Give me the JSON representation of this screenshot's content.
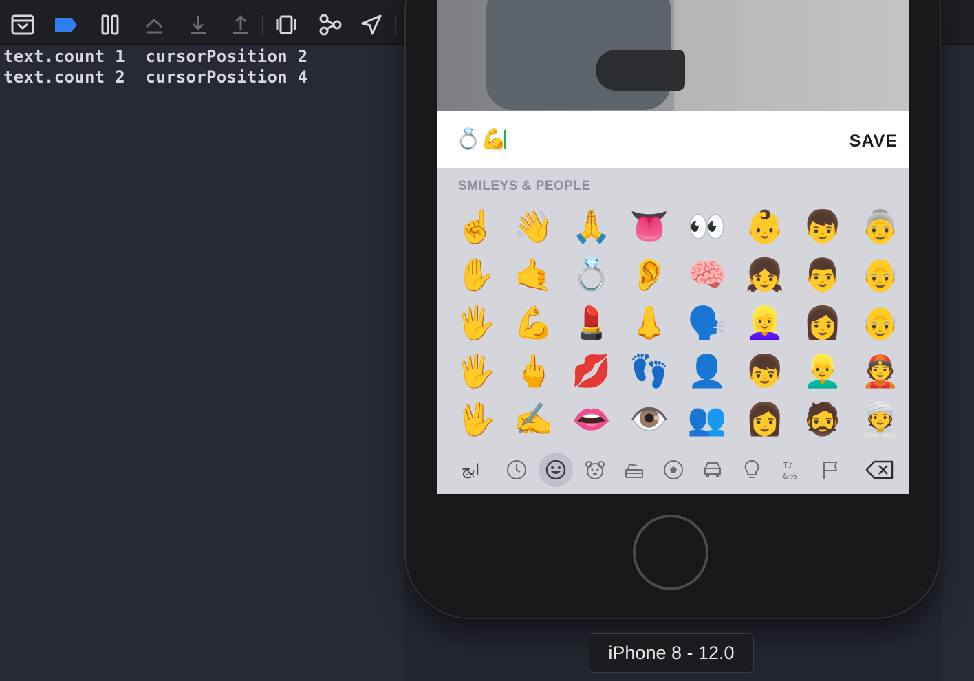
{
  "debug_toolbar": {
    "buttons": [
      {
        "name": "hide-debug-area-icon"
      },
      {
        "name": "breakpoints-toggle-icon"
      },
      {
        "name": "pause-icon"
      },
      {
        "name": "step-over-icon"
      },
      {
        "name": "step-into-icon"
      },
      {
        "name": "step-out-icon"
      },
      {
        "name": "view-debugger-icon"
      },
      {
        "name": "memory-graph-icon"
      },
      {
        "name": "simulate-location-icon"
      }
    ],
    "accent_color": "#2f7ff0"
  },
  "console": {
    "lines": [
      "text.count 1  cursorPosition 2",
      "text.count 2  cursorPosition 4"
    ]
  },
  "simulator": {
    "text_field_value": "💍💪",
    "save_label": "SAVE",
    "keyboard": {
      "section_title": "SMILEYS & PEOPLE",
      "emojis": [
        "☝️",
        "👋",
        "🙏",
        "👅",
        "👀",
        "👶",
        "👦",
        "👵",
        "✋",
        "🤙",
        "💍",
        "👂",
        "🧠",
        "👧",
        "👨",
        "👴",
        "🖐️",
        "💪",
        "💄",
        "👃",
        "🗣️",
        "👱‍♀️",
        "👩",
        "👴",
        "🖐",
        "🖕",
        "💋",
        "👣",
        "👤",
        "👦",
        "👱‍♂️",
        "👲",
        "🖖",
        "✍️",
        "👄",
        "👁️",
        "👥",
        "👩",
        "🧔",
        "👳"
      ],
      "abc_label": "ابج",
      "categories": [
        {
          "name": "recent-clock-icon"
        },
        {
          "name": "smileys-icon",
          "active": true
        },
        {
          "name": "animals-bear-icon"
        },
        {
          "name": "food-icon"
        },
        {
          "name": "activity-soccer-icon"
        },
        {
          "name": "travel-car-icon"
        },
        {
          "name": "objects-bulb-icon"
        },
        {
          "name": "symbols-icon"
        },
        {
          "name": "flags-icon"
        }
      ],
      "delete_icon": "backspace-icon"
    },
    "device_label": "iPhone 8 - 12.0"
  }
}
